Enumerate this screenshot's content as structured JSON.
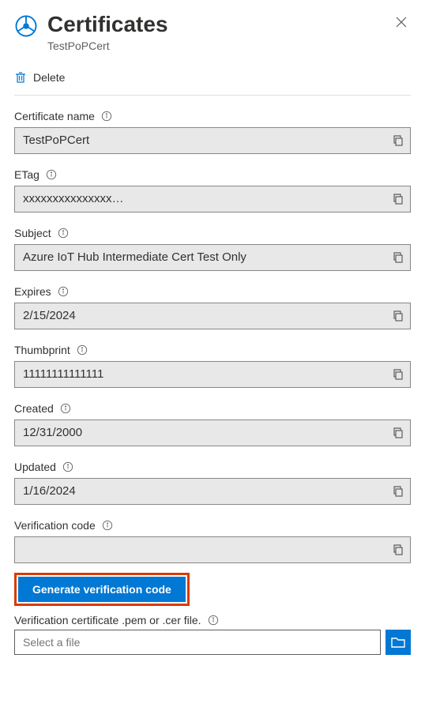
{
  "header": {
    "title": "Certificates",
    "subtitle": "TestPoPCert"
  },
  "actions": {
    "delete": "Delete",
    "generate": "Generate verification code"
  },
  "fields": {
    "certName": {
      "label": "Certificate name",
      "value": "TestPoPCert"
    },
    "etag": {
      "label": "ETag",
      "value": "xxxxxxxxxxxxxxx…"
    },
    "subject": {
      "label": "Subject",
      "value": "Azure IoT Hub Intermediate Cert Test Only"
    },
    "expires": {
      "label": "Expires",
      "value": "2/15/2024"
    },
    "thumbprint": {
      "label": "Thumbprint",
      "value": "11111111111111"
    },
    "created": {
      "label": "Created",
      "value": "12/31/2000"
    },
    "updated": {
      "label": "Updated",
      "value": "1/16/2024"
    },
    "verification": {
      "label": "Verification code",
      "value": ""
    }
  },
  "fileField": {
    "label": "Verification certificate .pem or .cer file.",
    "placeholder": "Select a file"
  }
}
